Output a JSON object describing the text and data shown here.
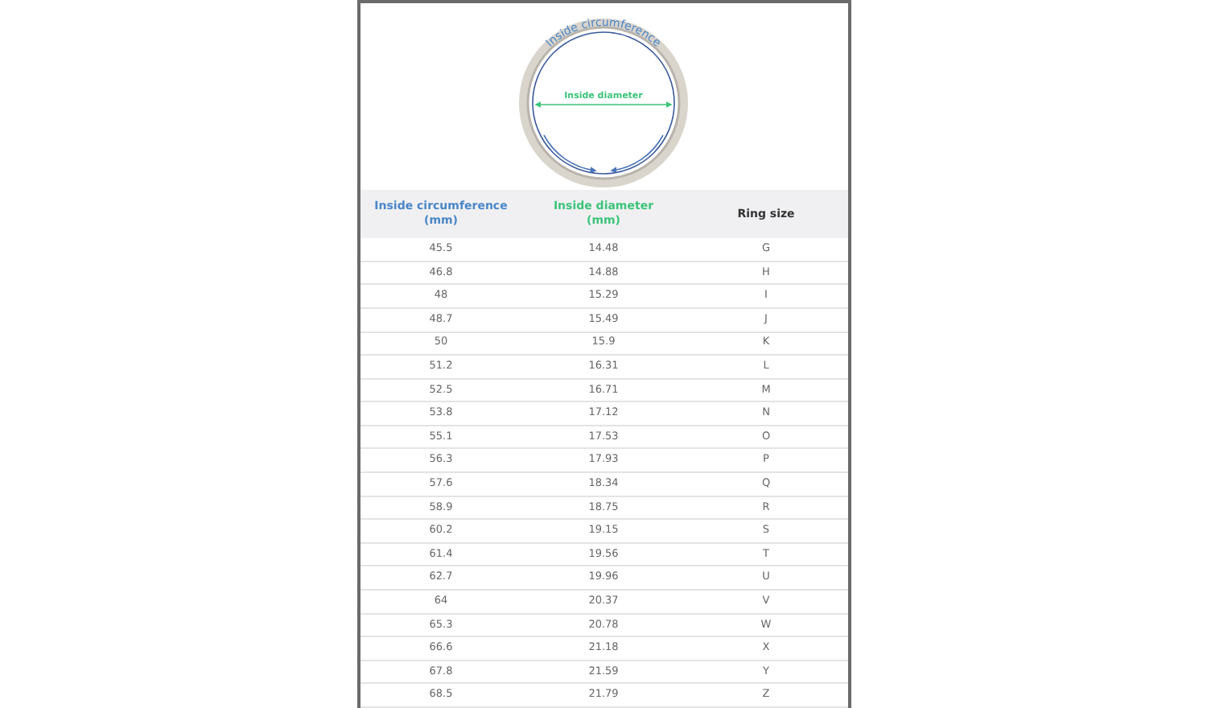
{
  "diagram": {
    "circumference_label": "Inside circumference",
    "diameter_label": "Inside diameter"
  },
  "table": {
    "columns": [
      {
        "label": "Inside circumference",
        "unit": "(mm)",
        "color": "#4a86c8"
      },
      {
        "label": "Inside diameter",
        "unit": "(mm)",
        "color": "#3cc47a"
      },
      {
        "label": "Ring size",
        "color": "#333333"
      }
    ],
    "rows": [
      [
        "45.5",
        "14.48",
        "G"
      ],
      [
        "46.8",
        "14.88",
        "H"
      ],
      [
        "48",
        "15.29",
        "I"
      ],
      [
        "48.7",
        "15.49",
        "J"
      ],
      [
        "50",
        "15.9",
        "K"
      ],
      [
        "51.2",
        "16.31",
        "L"
      ],
      [
        "52.5",
        "16.71",
        "M"
      ],
      [
        "53.8",
        "17.12",
        "N"
      ],
      [
        "55.1",
        "17.53",
        "O"
      ],
      [
        "56.3",
        "17.93",
        "P"
      ],
      [
        "57.6",
        "18.34",
        "Q"
      ],
      [
        "58.9",
        "18.75",
        "R"
      ],
      [
        "60.2",
        "19.15",
        "S"
      ],
      [
        "61.4",
        "19.56",
        "T"
      ],
      [
        "62.7",
        "19.96",
        "U"
      ],
      [
        "64",
        "20.37",
        "V"
      ],
      [
        "65.3",
        "20.78",
        "W"
      ],
      [
        "66.6",
        "21.18",
        "X"
      ],
      [
        "67.8",
        "21.59",
        "Y"
      ],
      [
        "68.5",
        "21.79",
        "Z"
      ]
    ]
  }
}
